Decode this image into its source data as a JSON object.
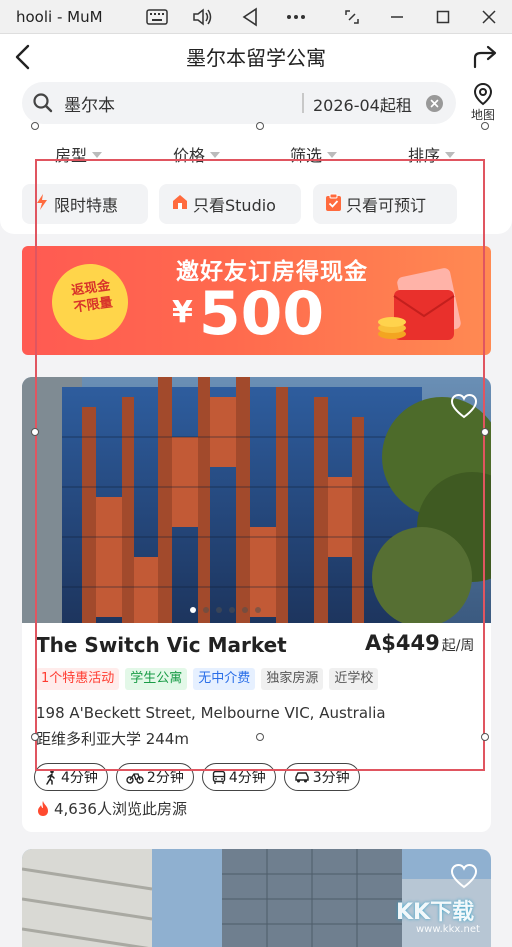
{
  "window": {
    "title": "hooli - MuM",
    "controls": [
      "keyboard-icon",
      "volume-icon",
      "back-triangle-icon",
      "more-icon",
      "screenshot-icon",
      "minimize-icon",
      "maximize-icon",
      "close-icon"
    ]
  },
  "nav": {
    "title": "墨尔本留学公寓"
  },
  "search": {
    "city": "墨尔本",
    "date": "2026-04起租",
    "map_label": "地图"
  },
  "filters": [
    {
      "label": "房型"
    },
    {
      "label": "价格"
    },
    {
      "label": "筛选"
    },
    {
      "label": "排序"
    }
  ],
  "chips": [
    {
      "label": "限时特惠",
      "icon": "lightning-icon"
    },
    {
      "label": "只看Studio",
      "icon": "house-icon"
    },
    {
      "label": "只看可预订",
      "icon": "clipboard-check-icon"
    }
  ],
  "banner": {
    "badge_line1": "返现金",
    "badge_line2": "不限量",
    "title": "邀好友订房得现金",
    "currency": "¥",
    "amount": "500"
  },
  "listing": {
    "name": "The Switch Vic Market",
    "price": "A$449",
    "unit": "起/周",
    "tags": [
      {
        "label": "1个特惠活动",
        "style": "red"
      },
      {
        "label": "学生公寓",
        "style": "green"
      },
      {
        "label": "无中介费",
        "style": "blue"
      },
      {
        "label": "独家房源",
        "style": "gray"
      },
      {
        "label": "近学校",
        "style": "gray"
      }
    ],
    "address": "198 A'Beckett Street, Melbourne VIC, Australia",
    "distance": "距维多利亚大学 244m",
    "transports": [
      {
        "mode": "walk-icon",
        "time": "4分钟"
      },
      {
        "mode": "bike-icon",
        "time": "2分钟"
      },
      {
        "mode": "bus-icon",
        "time": "4分钟"
      },
      {
        "mode": "car-icon",
        "time": "3分钟"
      }
    ],
    "views": "4,636人浏览此房源",
    "photo_count": 6,
    "active_photo": 1
  },
  "watermark": {
    "text": "KK下载",
    "sub": "www.kkx.net"
  },
  "colors": {
    "accent": "#ff5a52",
    "selection": "#e05560"
  }
}
